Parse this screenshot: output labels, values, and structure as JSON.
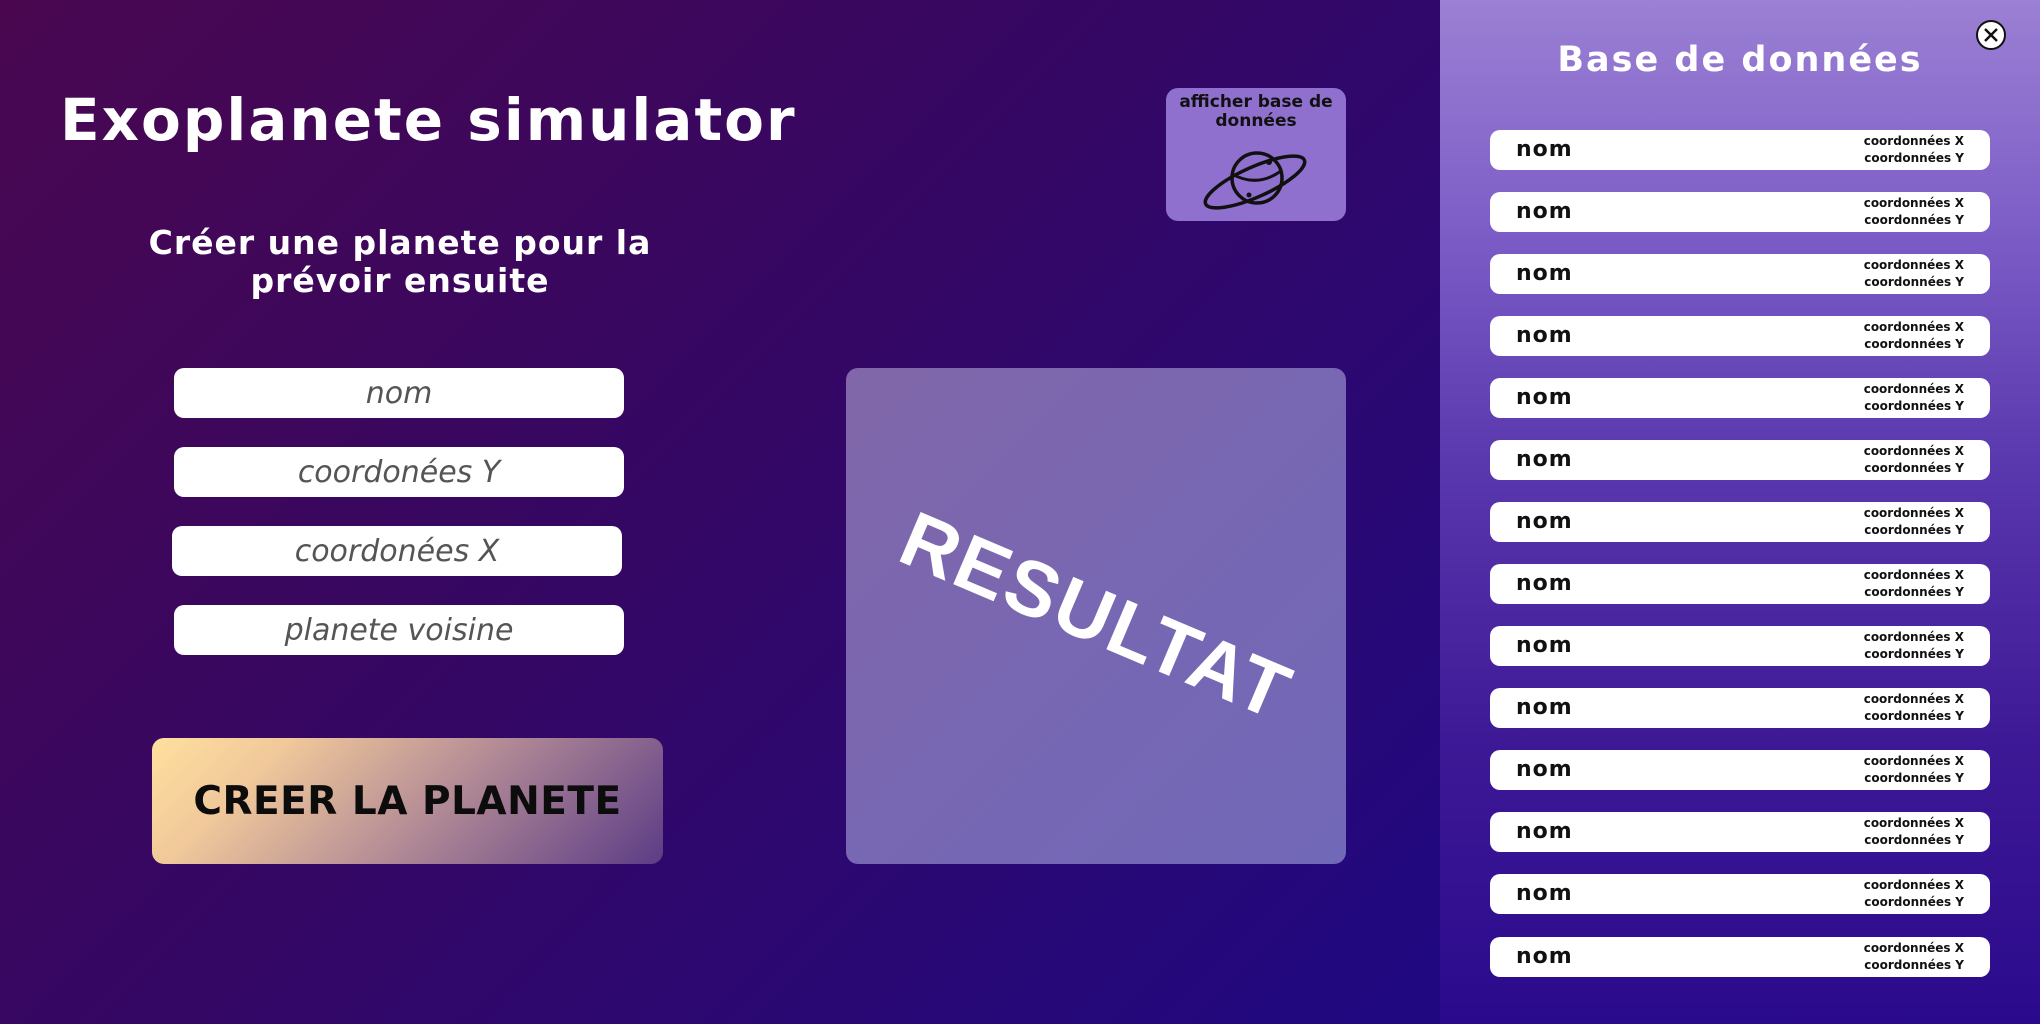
{
  "app": {
    "title": "Exoplanete simulator",
    "subtitle": "Créer une planete pour la prévoir ensuite"
  },
  "form": {
    "name_placeholder": "nom",
    "y_placeholder": "coordonées Y",
    "x_placeholder": "coordonées X",
    "neighbor_placeholder": "planete voisine",
    "submit_label": "CREER LA PLANETE"
  },
  "result": {
    "label": "RESULTAT"
  },
  "db_toggle": {
    "label": "afficher base de données",
    "icon": "planet-icon"
  },
  "database": {
    "title": "Base de données",
    "close_icon": "close-icon",
    "rows": [
      {
        "name": "nom",
        "coord_x": "coordonnées X",
        "coord_y": "coordonnées Y"
      },
      {
        "name": "nom",
        "coord_x": "coordonnées X",
        "coord_y": "coordonnées Y"
      },
      {
        "name": "nom",
        "coord_x": "coordonnées X",
        "coord_y": "coordonnées Y"
      },
      {
        "name": "nom",
        "coord_x": "coordonnées X",
        "coord_y": "coordonnées Y"
      },
      {
        "name": "nom",
        "coord_x": "coordonnées X",
        "coord_y": "coordonnées Y"
      },
      {
        "name": "nom",
        "coord_x": "coordonnées X",
        "coord_y": "coordonnées Y"
      },
      {
        "name": "nom",
        "coord_x": "coordonnées X",
        "coord_y": "coordonnées Y"
      },
      {
        "name": "nom",
        "coord_x": "coordonnées X",
        "coord_y": "coordonnées Y"
      },
      {
        "name": "nom",
        "coord_x": "coordonnées X",
        "coord_y": "coordonnées Y"
      },
      {
        "name": "nom",
        "coord_x": "coordonnées X",
        "coord_y": "coordonnées Y"
      },
      {
        "name": "nom",
        "coord_x": "coordonnées X",
        "coord_y": "coordonnées Y"
      },
      {
        "name": "nom",
        "coord_x": "coordonnées X",
        "coord_y": "coordonnées Y"
      },
      {
        "name": "nom",
        "coord_x": "coordonnées X",
        "coord_y": "coordonnées Y"
      },
      {
        "name": "nom",
        "coord_x": "coordonnées X",
        "coord_y": "coordonnées Y"
      }
    ]
  },
  "colors": {
    "background_start": "#4a0750",
    "background_end": "#150a8e",
    "panel_top": "#9b80d4",
    "panel_bottom": "#2a0a8c",
    "toggle_bg": "#9070ce",
    "result_bg": "#7767b3",
    "button_start": "#ffe09e",
    "button_end": "#5c3c86"
  }
}
